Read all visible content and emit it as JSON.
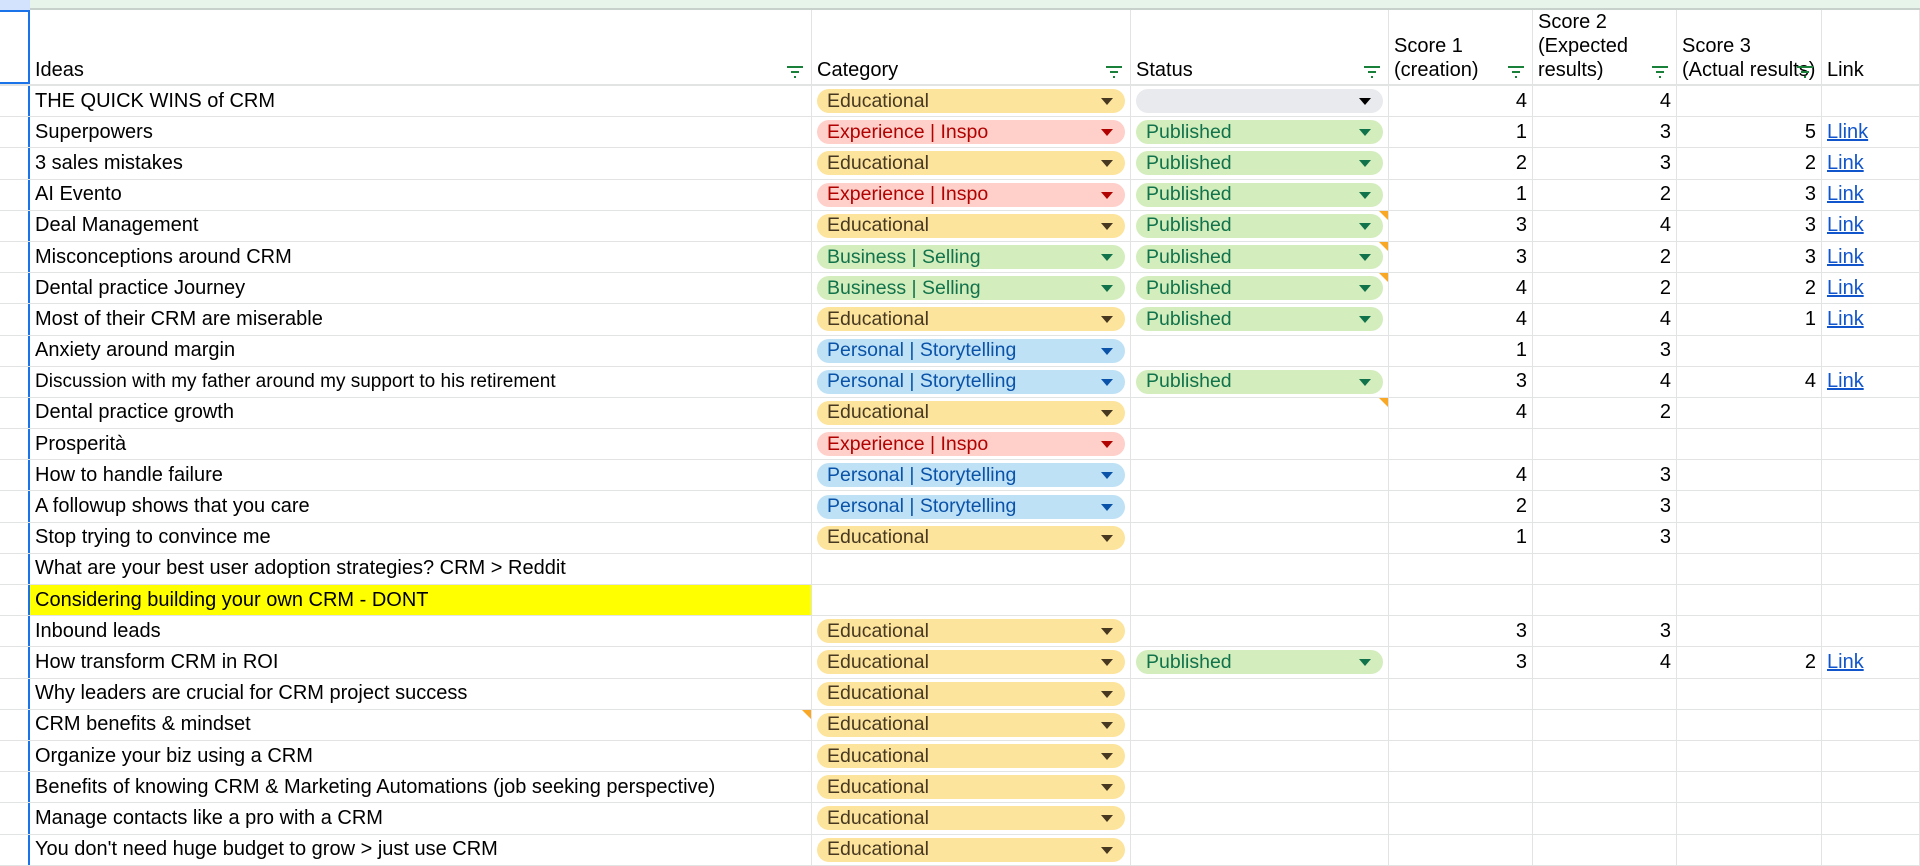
{
  "headers": [
    "Ideas",
    "Category",
    "Status",
    "Score 1 (creation)",
    "Score 2 (Expected results)",
    "Score 3 (Actual results)",
    "Link"
  ],
  "colors": {
    "Educational": [
      "#fde49c",
      "#473821"
    ],
    "Experience | Inspo": [
      "#ffcfc9",
      "#b10202"
    ],
    "Business | Selling": [
      "#d4edbc",
      "#11734b"
    ],
    "Personal | Storytelling": [
      "#bfe1f6",
      "#0a53a8"
    ],
    "Published": [
      "#d4edbc",
      "#11734b"
    ],
    "": [
      "#e8eaed",
      "#000000"
    ]
  },
  "rows": [
    {
      "idea": "THE QUICK WINS of CRM",
      "cat": "Educational",
      "status": "",
      "s1": "4",
      "s2": "4",
      "s3": "",
      "link": ""
    },
    {
      "idea": "Superpowers",
      "cat": "Experience | Inspo",
      "status": "Published",
      "s1": "1",
      "s2": "3",
      "s3": "5",
      "link": "Llink"
    },
    {
      "idea": "3 sales mistakes",
      "cat": "Educational",
      "status": "Published",
      "s1": "2",
      "s2": "3",
      "s3": "2",
      "link": "Link"
    },
    {
      "idea": "AI Evento",
      "cat": "Experience | Inspo",
      "status": "Published",
      "s1": "1",
      "s2": "2",
      "s3": "3",
      "link": "Link"
    },
    {
      "idea": "Deal Management",
      "cat": "Educational",
      "status": "Published",
      "s1": "3",
      "s2": "4",
      "s3": "3",
      "link": "Link",
      "note": "status"
    },
    {
      "idea": "Misconceptions around CRM",
      "cat": "Business | Selling",
      "status": "Published",
      "s1": "3",
      "s2": "2",
      "s3": "3",
      "link": "Link",
      "note": "status"
    },
    {
      "idea": "Dental practice Journey",
      "cat": "Business | Selling",
      "status": "Published",
      "s1": "4",
      "s2": "2",
      "s3": "2",
      "link": "Link",
      "note": "status"
    },
    {
      "idea": "Most of their CRM are miserable",
      "cat": "Educational",
      "status": "Published",
      "s1": "4",
      "s2": "4",
      "s3": "1",
      "link": "Link"
    },
    {
      "idea": "Anxiety around margin",
      "cat": "Personal | Storytelling",
      "s1": "1",
      "s2": "3"
    },
    {
      "idea": "Discussion with my father around my support to his retirement",
      "cat": "Personal | Storytelling",
      "status": "Published",
      "s1": "3",
      "s2": "4",
      "s3": "4",
      "link": "Link",
      "arial": true
    },
    {
      "idea": "Dental practice growth",
      "cat": "Educational",
      "s1": "4",
      "s2": "2",
      "note": "status"
    },
    {
      "idea": "Prosperità",
      "cat": "Experience | Inspo"
    },
    {
      "idea": "How to handle failure",
      "cat": "Personal | Storytelling",
      "s1": "4",
      "s2": "3"
    },
    {
      "idea": "A followup shows that you care",
      "cat": "Personal | Storytelling",
      "s1": "2",
      "s2": "3"
    },
    {
      "idea": "Stop trying to convince me",
      "cat": "Educational",
      "s1": "1",
      "s2": "3"
    },
    {
      "idea": "What are your best user adoption strategies? CRM > Reddit"
    },
    {
      "idea": "Considering building your own CRM - DONT",
      "yellow": true
    },
    {
      "idea": "Inbound leads",
      "cat": "Educational",
      "s1": "3",
      "s2": "3"
    },
    {
      "idea": "How transform CRM in ROI",
      "cat": "Educational",
      "status": "Published",
      "s1": "3",
      "s2": "4",
      "s3": "2",
      "link": "Link"
    },
    {
      "idea": "Why leaders are crucial for CRM project success",
      "cat": "Educational"
    },
    {
      "idea": "CRM benefits & mindset",
      "cat": "Educational",
      "note": "idea"
    },
    {
      "idea": "Organize your biz using a CRM",
      "cat": "Educational"
    },
    {
      "idea": "Benefits of knowing CRM & Marketing Automations (job seeking perspective)",
      "cat": "Educational"
    },
    {
      "idea": "Manage contacts like a pro with a CRM",
      "cat": "Educational"
    },
    {
      "idea": "You don't need huge budget to grow > just use CRM",
      "cat": "Educational"
    }
  ]
}
